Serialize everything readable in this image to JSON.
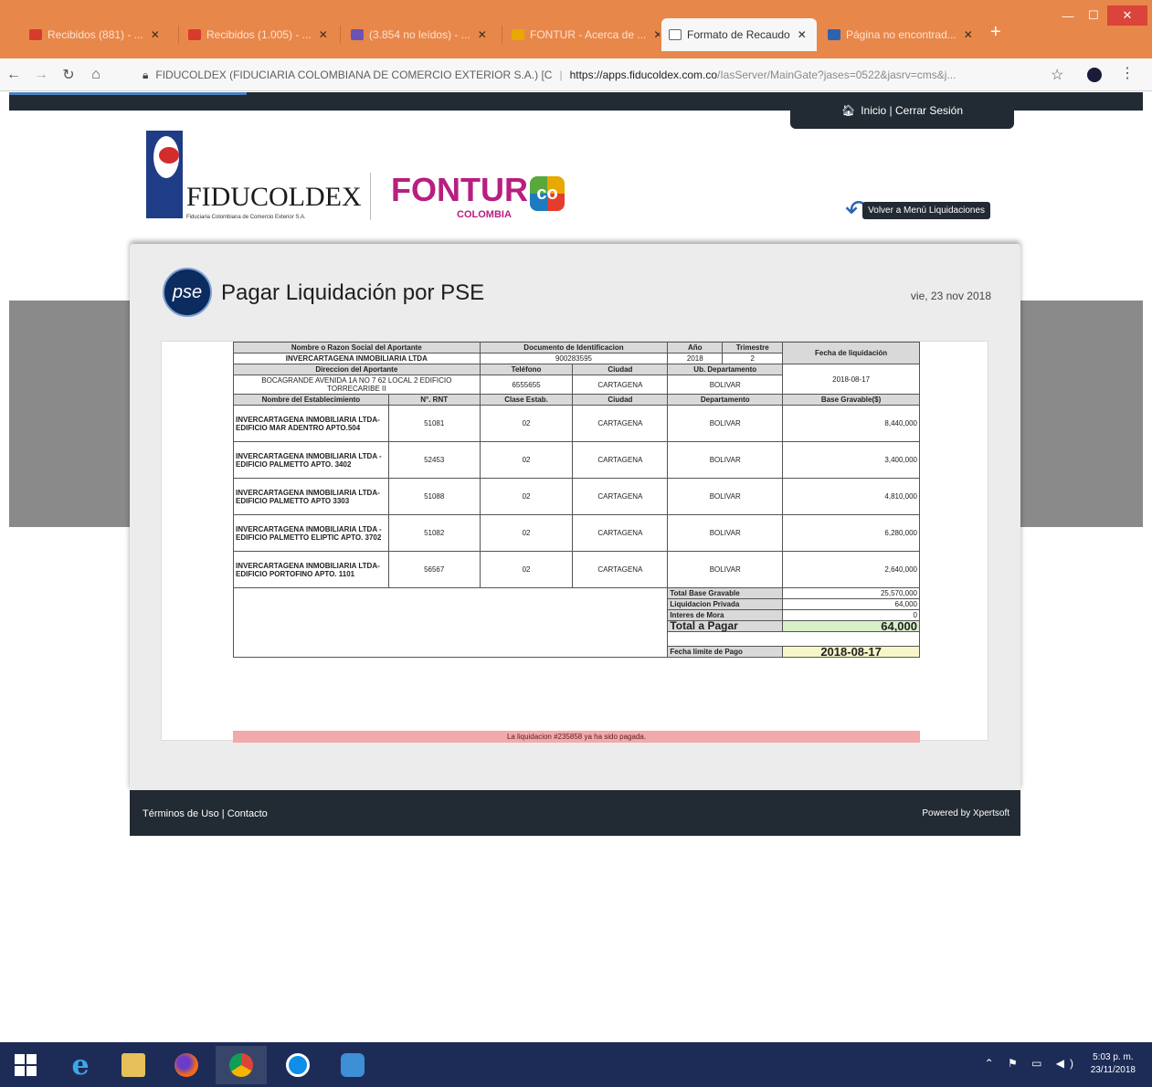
{
  "browser": {
    "tabs": [
      {
        "label": "Recibidos (881) - ...",
        "fav": "#d83b2b"
      },
      {
        "label": "Recibidos (1.005) - ...",
        "fav": "#d83b2b"
      },
      {
        "label": "(3.854 no leídos) - ...",
        "fav": "#6b52b5"
      },
      {
        "label": "FONTUR - Acerca de ...",
        "fav": "#e8a800"
      },
      {
        "label": "Formato de Recaudo",
        "fav": "#ffffff"
      },
      {
        "label": "Página no encontrad...",
        "fav": "#2c63b0"
      }
    ],
    "address_prefix": "FIDUCOLDEX (FIDUCIARIA COLOMBIANA DE COMERCIO EXTERIOR S.A.) [C",
    "address_host": "https://apps.fiducoldex.com.co",
    "address_path": "/IasServer/MainGate?jases=0522&jasrv=cms&j..."
  },
  "header": {
    "user_links": "Inicio | Cerrar Sesión",
    "back_label": "Volver a Menú Liquidaciones"
  },
  "logos": {
    "fiducoldex_name": "FIDUCOLDEX",
    "fiducoldex_sub": "Fiduciaria Colombiana de Comercio Exterior S.A.",
    "fontur_name": "FONTUR",
    "fontur_country": "COLOMBIA",
    "fontur_badge": "co",
    "pse_text": "pse"
  },
  "card": {
    "title": "Pagar Liquidación por PSE",
    "date": "vie, 23 nov 2018"
  },
  "liquidacion": {
    "h_nombre": "Nombre o Razon Social del Aportante",
    "h_documento": "Documento de Identificacion",
    "h_anio": "Año",
    "h_trimestre": "Trimestre",
    "h_fecha_liq": "Fecha de liquidación",
    "nombre": "INVERCARTAGENA INMOBILIARIA LTDA",
    "documento": "900283595",
    "anio": "2018",
    "trimestre": "2",
    "fecha_liq": "2018-08-17",
    "h_direccion": "Direccion del Aportante",
    "h_telefono": "Teléfono",
    "h_ciudad": "Ciudad",
    "h_departamento_aport": "Ub. Departamento",
    "direccion": "BOCAGRANDE AVENIDA 1A NO 7 62 LOCAL 2 EDIFICIO TORRECARIBE II",
    "telefono": "6555655",
    "ciudad": "CARTAGENA",
    "departamento": "BOLIVAR",
    "eh_nombre": "Nombre del Establecimiento",
    "eh_rnt": "N°. RNT",
    "eh_clase": "Clase Estab.",
    "eh_ciudad": "Ciudad",
    "eh_depto": "Departamento",
    "eh_base": "Base Gravable($)",
    "establecimientos": [
      {
        "nombre": "INVERCARTAGENA INMOBILIARIA LTDA- EDIFICIO MAR ADENTRO APTO.504",
        "rnt": "51081",
        "clase": "02",
        "ciudad": "CARTAGENA",
        "depto": "BOLIVAR",
        "base": "8,440,000"
      },
      {
        "nombre": "INVERCARTAGENA INMOBILIARIA LTDA - EDIFICIO PALMETTO APTO. 3402",
        "rnt": "52453",
        "clase": "02",
        "ciudad": "CARTAGENA",
        "depto": "BOLIVAR",
        "base": "3,400,000"
      },
      {
        "nombre": "INVERCARTAGENA INMOBILIARIA LTDA- EDIFICIO PALMETTO APTO 3303",
        "rnt": "51088",
        "clase": "02",
        "ciudad": "CARTAGENA",
        "depto": "BOLIVAR",
        "base": "4,810,000"
      },
      {
        "nombre": "INVERCARTAGENA INMOBILIARIA LTDA - EDIFICIO PALMETTO ELIPTIC APTO. 3702",
        "rnt": "51082",
        "clase": "02",
        "ciudad": "CARTAGENA",
        "depto": "BOLIVAR",
        "base": "6,280,000"
      },
      {
        "nombre": "INVERCARTAGENA INMOBILIARIA LTDA- EDIFICIO PORTOFINO APTO. 1101",
        "rnt": "56567",
        "clase": "02",
        "ciudad": "CARTAGENA",
        "depto": "BOLIVAR",
        "base": "2,640,000"
      }
    ],
    "total_base_label": "Total Base Gravable",
    "total_base": "25,570,000",
    "liq_privada_label": "Liquidacion Privada",
    "liq_privada": "64,000",
    "intereses_label": "Interes de Mora",
    "intereses": "0",
    "total_label": "Total a Pagar",
    "total": "64,000",
    "fecha_limite_label": "Fecha limite de Pago",
    "fecha_limite": "2018-08-17",
    "paid_notice": "La liquidacion #235858 ya ha sido pagada."
  },
  "footer": {
    "links": "Términos de Uso | Contacto",
    "powered": "Powered by Xpertsoft"
  },
  "taskbar": {
    "time": "5:03 p. m.",
    "date": "23/11/2018"
  }
}
